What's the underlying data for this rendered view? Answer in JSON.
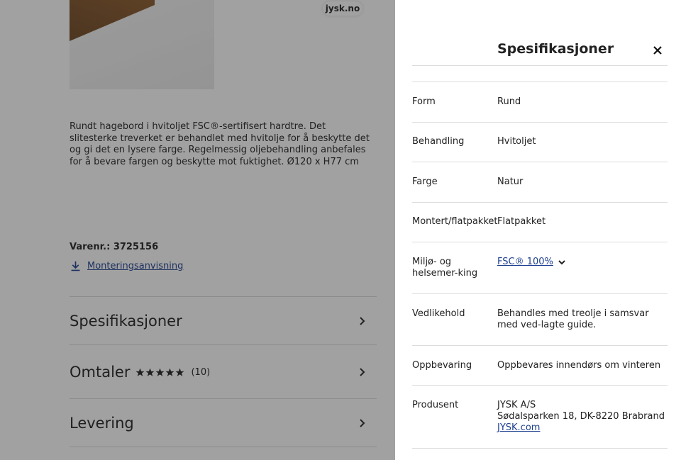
{
  "browser": {
    "domain": "jysk.no"
  },
  "product": {
    "description": "Rundt hagebord i hvitoljet FSC®-sertifisert hardtre. Det slitesterke treverket er behandlet med hvitolje for å beskytte det og gi det en lysere farge. Regelmessig oljebehandling anbefales for å bevare fargen og beskytte mot fuktighet. Ø120 x H77 cm",
    "article_number": "Varenr.: 3725156",
    "assembly_link": "Monteringsanvisning"
  },
  "accordion": {
    "specs": "Spesifikasjoner",
    "reviews": "Omtaler",
    "reviews_count": "(10)",
    "rating": 5,
    "delivery": "Levering"
  },
  "panel": {
    "title": "Spesifikasjoner",
    "rows": [
      {
        "label": "Form",
        "value": "Rund"
      },
      {
        "label": "Behandling",
        "value": "Hvitoljet"
      },
      {
        "label": "Farge",
        "value": "Natur"
      },
      {
        "label": "Montert/flatpakket",
        "value": "Flatpakket"
      },
      {
        "label": "Miljø- og helsemer-king",
        "value": "FSC® 100%"
      },
      {
        "label": "Vedlikehold",
        "value": "Behandles med treolje i samsvar med ved-lagte guide."
      },
      {
        "label": "Oppbevaring",
        "value": "Oppbevares innendørs om vinteren"
      },
      {
        "label": "Produsent",
        "value": "JYSK A/S",
        "address": "Sødalsparken 18, DK-8220 Brabrand",
        "link": "JYSK.com"
      }
    ]
  },
  "colors": {
    "link": "#1d3f8f",
    "divider": "#dcdcdc",
    "overlay": "#1e1e1e"
  }
}
